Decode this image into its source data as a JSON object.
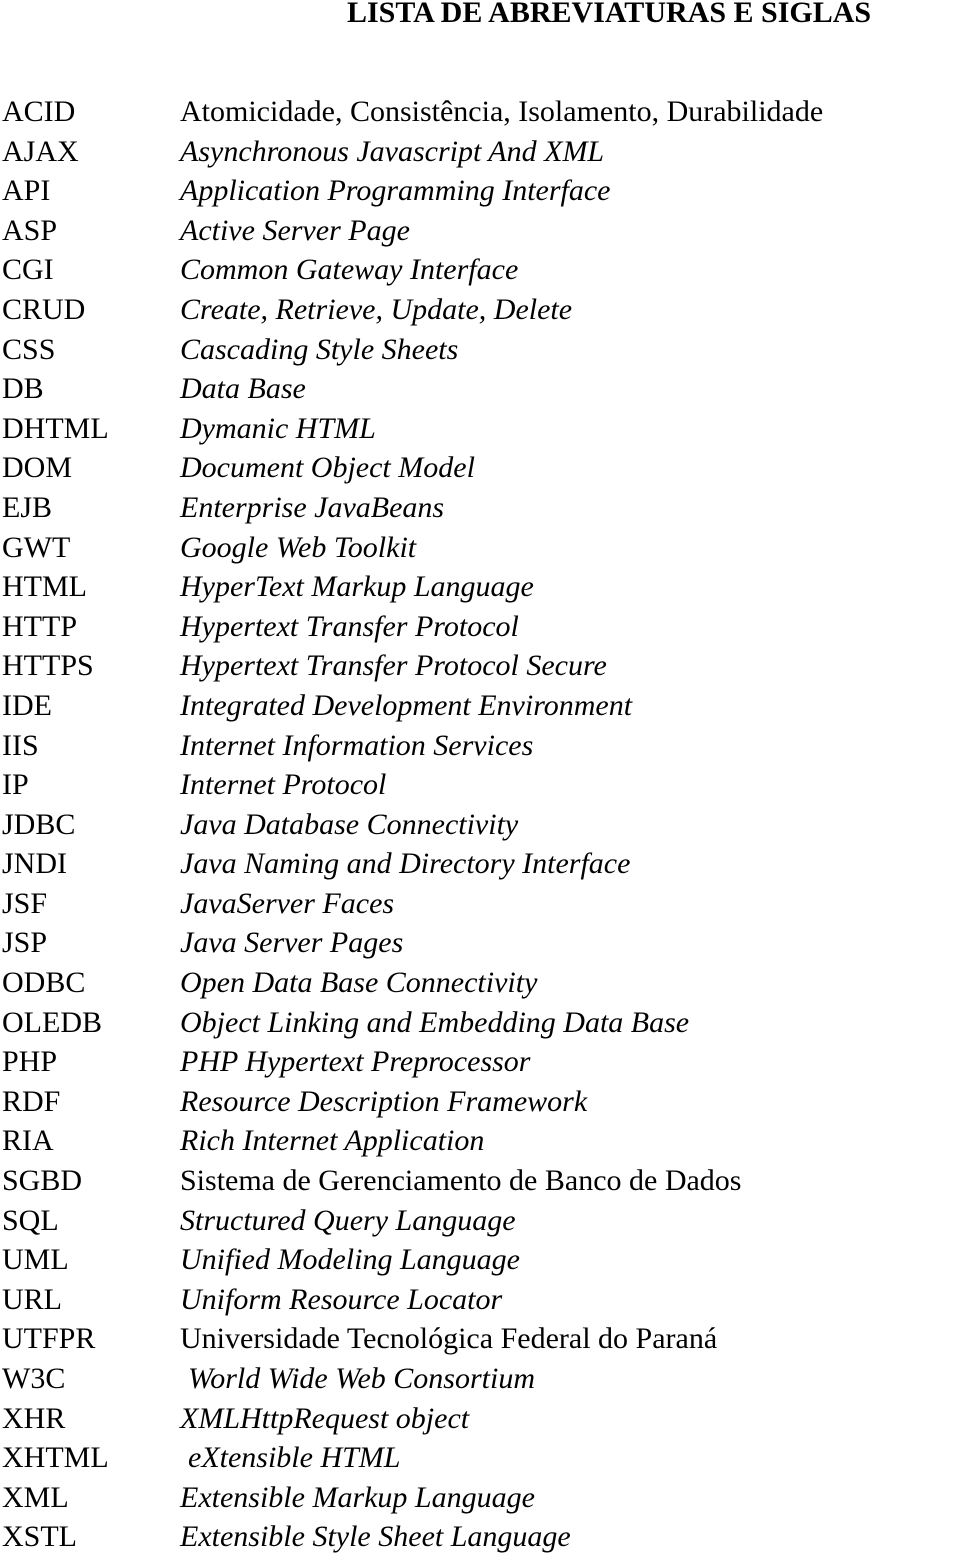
{
  "title": "LISTA DE ABREVIATURAS E SIGLAS",
  "entries": [
    {
      "abbr": "ACID",
      "desc": "Atomicidade, Consistência, Isolamento, Durabilidade",
      "italic": false
    },
    {
      "abbr": "AJAX",
      "desc": "Asynchronous Javascript And XML",
      "italic": true
    },
    {
      "abbr": "API",
      "desc": "Application Programming Interface",
      "italic": true
    },
    {
      "abbr": "ASP",
      "desc": "Active Server Page",
      "italic": true
    },
    {
      "abbr": "CGI",
      "desc": "Common Gateway Interface",
      "italic": true
    },
    {
      "abbr": "CRUD",
      "desc": "Create, Retrieve, Update, Delete",
      "italic": true
    },
    {
      "abbr": "CSS",
      "desc": "Cascading Style Sheets",
      "italic": true
    },
    {
      "abbr": "DB",
      "desc": "Data Base",
      "italic": true
    },
    {
      "abbr": "DHTML",
      "desc": "Dymanic HTML",
      "italic": true
    },
    {
      "abbr": "DOM",
      "desc": "Document Object Model",
      "italic": true
    },
    {
      "abbr": "EJB",
      "desc": "Enterprise JavaBeans",
      "italic": true
    },
    {
      "abbr": "GWT",
      "desc": "Google Web Toolkit",
      "italic": true
    },
    {
      "abbr": "HTML",
      "desc": "HyperText Markup Language",
      "italic": true
    },
    {
      "abbr": "HTTP",
      "desc": "Hypertext Transfer Protocol",
      "italic": true
    },
    {
      "abbr": "HTTPS",
      "desc": "Hypertext Transfer Protocol Secure",
      "italic": true
    },
    {
      "abbr": "IDE",
      "desc": "Integrated Development Environment",
      "italic": true
    },
    {
      "abbr": "IIS",
      "desc": "Internet Information Services",
      "italic": true
    },
    {
      "abbr": "IP",
      "desc": "Internet Protocol",
      "italic": true
    },
    {
      "abbr": "JDBC",
      "desc": "Java Database Connectivity",
      "italic": true
    },
    {
      "abbr": "JNDI",
      "desc": "Java Naming and Directory Interface",
      "italic": true
    },
    {
      "abbr": "JSF",
      "desc": "JavaServer Faces",
      "italic": true
    },
    {
      "abbr": "JSP",
      "desc": "Java Server Pages",
      "italic": true
    },
    {
      "abbr": "ODBC",
      "desc": "Open Data Base Connectivity",
      "italic": true
    },
    {
      "abbr": "OLEDB",
      "desc": "Object Linking and Embedding Data Base",
      "italic": true
    },
    {
      "abbr": "PHP",
      "desc": "PHP Hypertext Preprocessor",
      "italic": true
    },
    {
      "abbr": "RDF",
      "desc": "Resource Description Framework",
      "italic": true
    },
    {
      "abbr": "RIA",
      "desc": "Rich Internet Application",
      "italic": true
    },
    {
      "abbr": "SGBD",
      "desc": "Sistema de Gerenciamento de Banco de Dados",
      "italic": false
    },
    {
      "abbr": "SQL",
      "desc": "Structured Query Language",
      "italic": true
    },
    {
      "abbr": "UML",
      "desc": "Unified Modeling Language",
      "italic": true
    },
    {
      "abbr": "URL",
      "desc": "Uniform Resource Locator",
      "italic": true
    },
    {
      "abbr": "UTFPR",
      "desc": "Universidade Tecnológica Federal do Paraná",
      "italic": false
    },
    {
      "abbr": "W3C",
      "desc": "World Wide Web Consortium",
      "italic": true,
      "indent": true
    },
    {
      "abbr": "XHR",
      "desc": "XMLHttpRequest object",
      "italic": true
    },
    {
      "abbr": "XHTML",
      "desc": "eXtensible HTML",
      "italic": true,
      "indent": true
    },
    {
      "abbr": "XML",
      "desc": "Extensible Markup Language",
      "italic": true
    },
    {
      "abbr": "XSTL",
      "desc": "Extensible Style Sheet Language",
      "italic": true
    }
  ]
}
